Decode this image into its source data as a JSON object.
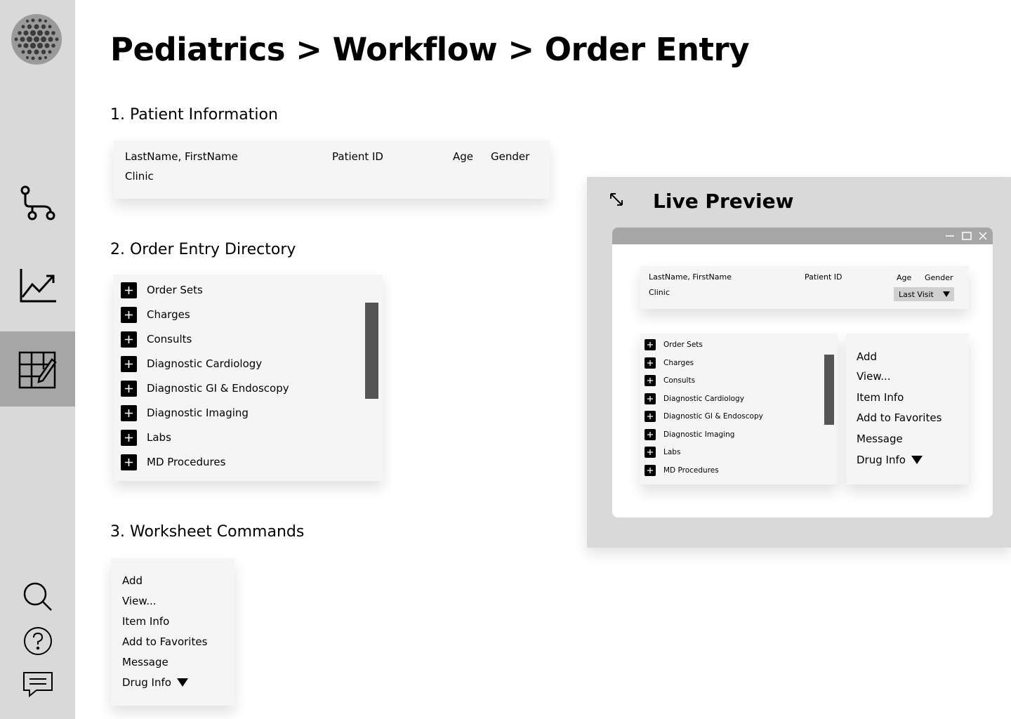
{
  "breadcrumb": {
    "title": "Pediatrics > Workflow > Order Entry"
  },
  "sidebar": {
    "logo_icon": "sphere-logo-icon",
    "nav": [
      {
        "icon": "workflow-icon",
        "active": false
      },
      {
        "icon": "analytics-chart-icon",
        "active": false
      },
      {
        "icon": "order-grid-edit-icon",
        "active": true
      }
    ],
    "bottom": [
      {
        "icon": "search-icon"
      },
      {
        "icon": "help-icon"
      },
      {
        "icon": "chat-icon"
      }
    ]
  },
  "sections": {
    "patient_info_title": "1. Patient Information",
    "directory_title": "2. Order Entry Directory",
    "commands_title": "3. Worksheet Commands"
  },
  "patient": {
    "name_label": "LastName, FirstName",
    "id_label": "Patient ID",
    "age_label": "Age",
    "gender_label": "Gender",
    "clinic_label": "Clinic"
  },
  "directory": {
    "items": [
      "Order Sets",
      "Charges",
      "Consults",
      "Diagnostic Cardiology",
      "Diagnostic GI & Endoscopy",
      "Diagnostic Imaging",
      "Labs",
      "MD Procedures"
    ]
  },
  "commands": {
    "items": [
      "Add",
      "View...",
      "Item Info",
      "Add to Favorites",
      "Message",
      "Drug Info"
    ]
  },
  "live_preview": {
    "title": "Live Preview",
    "last_visit": "Last Visit"
  },
  "colors": {
    "sidebar_bg": "#d9d9d9",
    "sidebar_active": "#a6a6a6",
    "card_bg": "#f5f5f5",
    "scrollbar": "#555555",
    "preview_titlebar": "#a6a6a6"
  }
}
